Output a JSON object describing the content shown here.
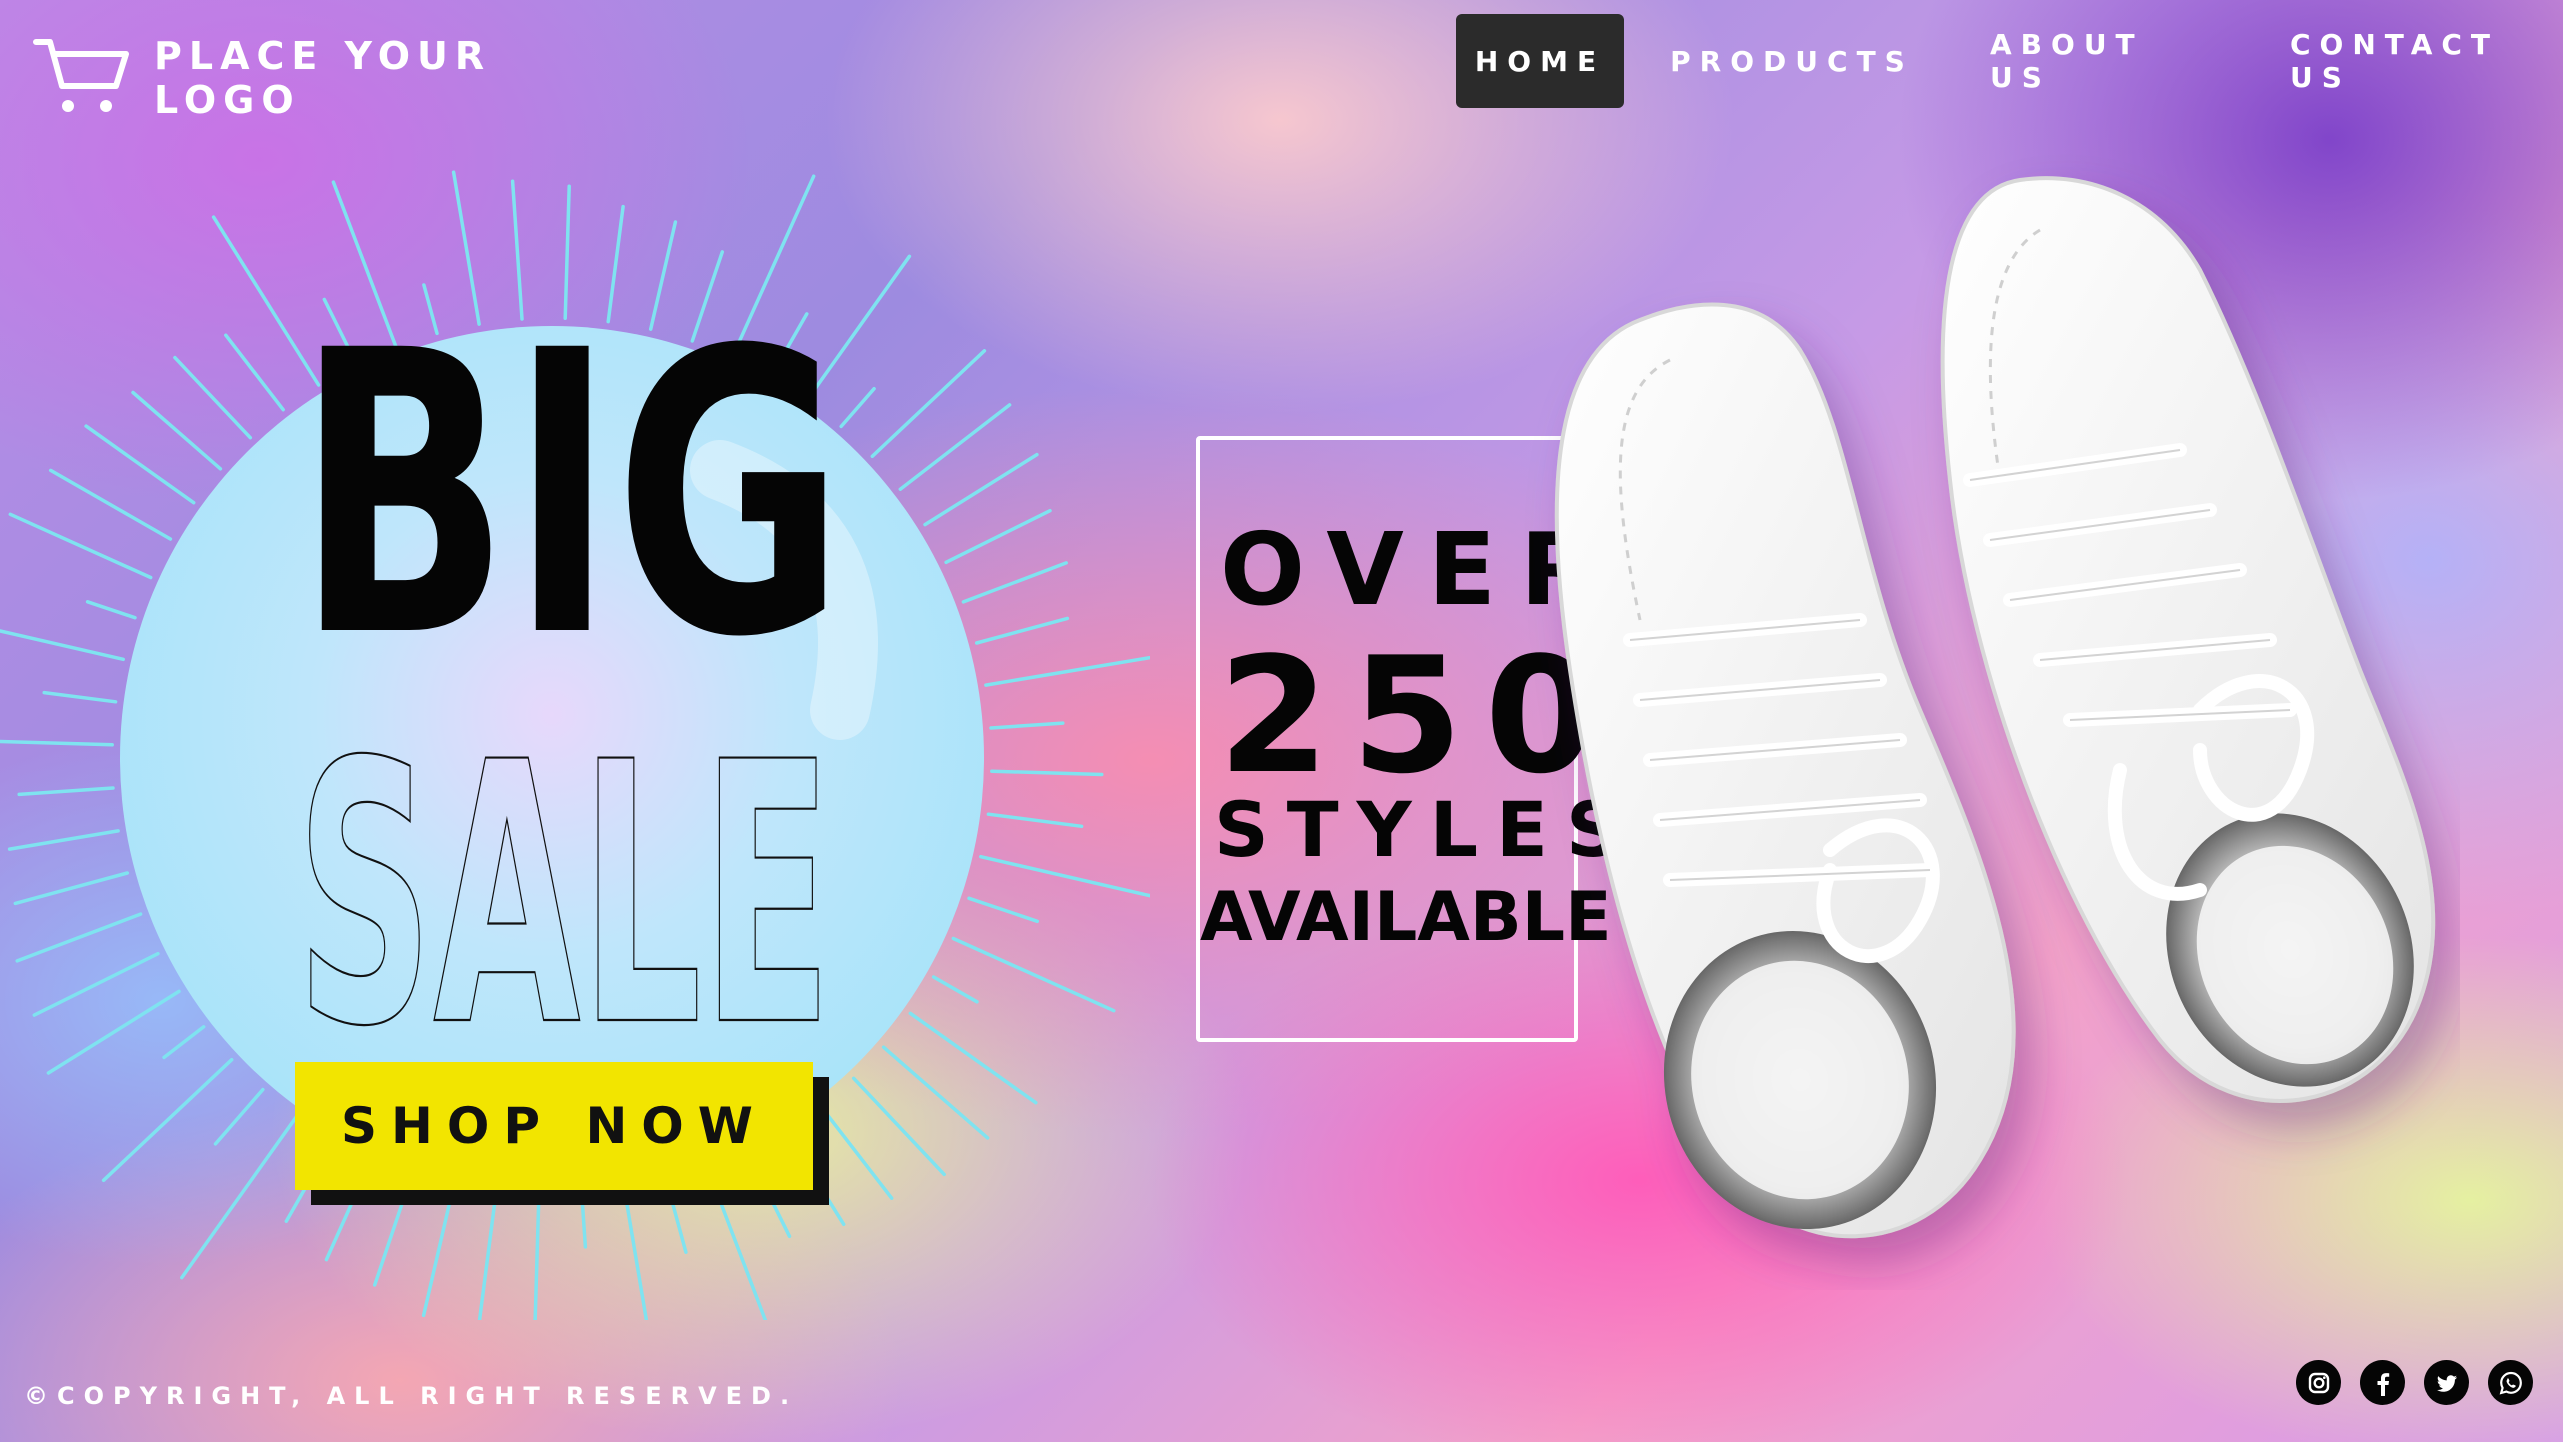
{
  "header": {
    "logo_line1": "PLACE YOUR",
    "logo_line2": "LOGO",
    "logo_icon": "shopping-cart-icon",
    "nav": [
      {
        "label": "HOME",
        "active": true
      },
      {
        "label": "PRODUCTS",
        "active": false
      },
      {
        "label": "ABOUT US",
        "active": false
      },
      {
        "label": "CONTACT US",
        "active": false
      }
    ]
  },
  "hero": {
    "headline_1": "BIG",
    "headline_2": "SALE",
    "cta_label": "SHOP NOW",
    "cta_color": "#f2e500"
  },
  "promo": {
    "line1": "OVER",
    "number": "250",
    "line3": "STYLES",
    "line4": "AVAILABLE"
  },
  "footer": {
    "copyright": "©COPYRIGHT, ALL RIGHT RESERVED.",
    "socials": [
      "instagram-icon",
      "facebook-icon",
      "twitter-icon",
      "whatsapp-icon"
    ]
  },
  "colors": {
    "accent_yellow": "#f2e500",
    "nav_active_bg": "#2b2b2b",
    "burst_lines": "#7fe3f0"
  }
}
